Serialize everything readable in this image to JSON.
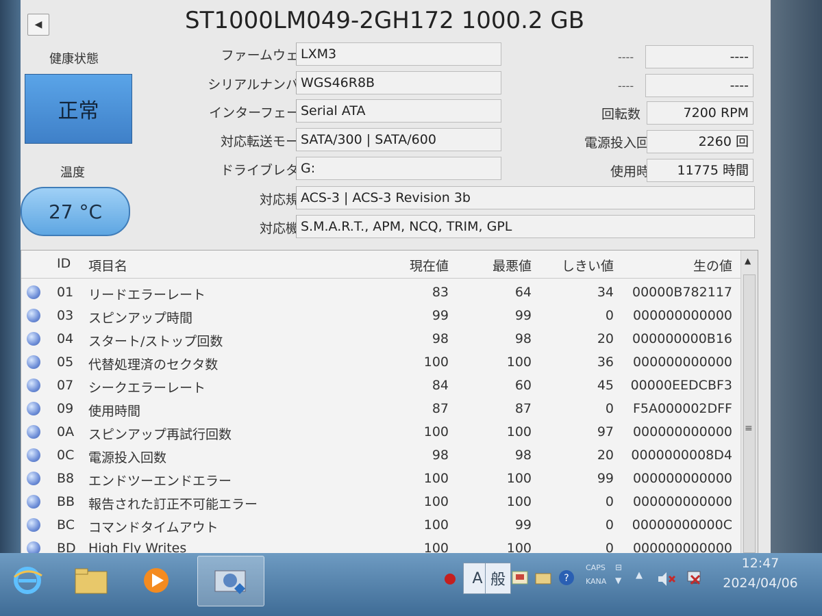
{
  "title": "ST1000LM049-2GH172 1000.2 GB",
  "health": {
    "label": "健康状態",
    "value": "正常"
  },
  "temperature": {
    "label": "温度",
    "value": "27 °C"
  },
  "info": [
    {
      "label": "ファームウェア",
      "value": "LXM3"
    },
    {
      "label": "シリアルナンバー",
      "value": "WGS46R8B"
    },
    {
      "label": "インターフェース",
      "value": "Serial ATA"
    },
    {
      "label": "対応転送モード",
      "value": "SATA/300 | SATA/600"
    },
    {
      "label": "ドライブレター",
      "value": "G:"
    },
    {
      "label": "対応規格",
      "value": "ACS-3 | ACS-3 Revision 3b"
    },
    {
      "label": "対応機能",
      "value": "S.M.A.R.T., APM, NCQ, TRIM, GPL"
    }
  ],
  "right_info": [
    {
      "label": "----",
      "value": "----"
    },
    {
      "label": "----",
      "value": "----"
    },
    {
      "label": "回転数",
      "value": "7200 RPM"
    },
    {
      "label": "電源投入回数",
      "value": "2260 回"
    },
    {
      "label": "使用時間",
      "value": "11775 時間"
    }
  ],
  "table": {
    "headers": {
      "id": "ID",
      "name": "項目名",
      "current": "現在値",
      "worst": "最悪値",
      "threshold": "しきい値",
      "raw": "生の値"
    },
    "rows": [
      {
        "id": "01",
        "name": "リードエラーレート",
        "current": "83",
        "worst": "64",
        "threshold": "34",
        "raw": "00000B782117"
      },
      {
        "id": "03",
        "name": "スピンアップ時間",
        "current": "99",
        "worst": "99",
        "threshold": "0",
        "raw": "000000000000"
      },
      {
        "id": "04",
        "name": "スタート/ストップ回数",
        "current": "98",
        "worst": "98",
        "threshold": "20",
        "raw": "000000000B16"
      },
      {
        "id": "05",
        "name": "代替処理済のセクタ数",
        "current": "100",
        "worst": "100",
        "threshold": "36",
        "raw": "000000000000"
      },
      {
        "id": "07",
        "name": "シークエラーレート",
        "current": "84",
        "worst": "60",
        "threshold": "45",
        "raw": "00000EEDCBF3"
      },
      {
        "id": "09",
        "name": "使用時間",
        "current": "87",
        "worst": "87",
        "threshold": "0",
        "raw": "F5A000002DFF"
      },
      {
        "id": "0A",
        "name": "スピンアップ再試行回数",
        "current": "100",
        "worst": "100",
        "threshold": "97",
        "raw": "000000000000"
      },
      {
        "id": "0C",
        "name": "電源投入回数",
        "current": "98",
        "worst": "98",
        "threshold": "20",
        "raw": "0000000008D4"
      },
      {
        "id": "B8",
        "name": "エンドツーエンドエラー",
        "current": "100",
        "worst": "100",
        "threshold": "99",
        "raw": "000000000000"
      },
      {
        "id": "BB",
        "name": "報告された訂正不可能エラー",
        "current": "100",
        "worst": "100",
        "threshold": "0",
        "raw": "000000000000"
      },
      {
        "id": "BC",
        "name": "コマンドタイムアウト",
        "current": "100",
        "worst": "99",
        "threshold": "0",
        "raw": "00000000000C"
      },
      {
        "id": "BD",
        "name": "High Fly Writes",
        "current": "100",
        "worst": "100",
        "threshold": "0",
        "raw": "000000000000"
      }
    ]
  },
  "taskbar": {
    "tray": {
      "caps": "CAPS",
      "kana": "KANA",
      "ime_mode": "A",
      "ime_general": "般"
    },
    "clock_time": "12:47",
    "clock_date": "2024/04/06"
  },
  "colors": {
    "health_good": "#4a90d9",
    "temp": "#8cc4f0",
    "taskbar": "#4f7ca6"
  }
}
